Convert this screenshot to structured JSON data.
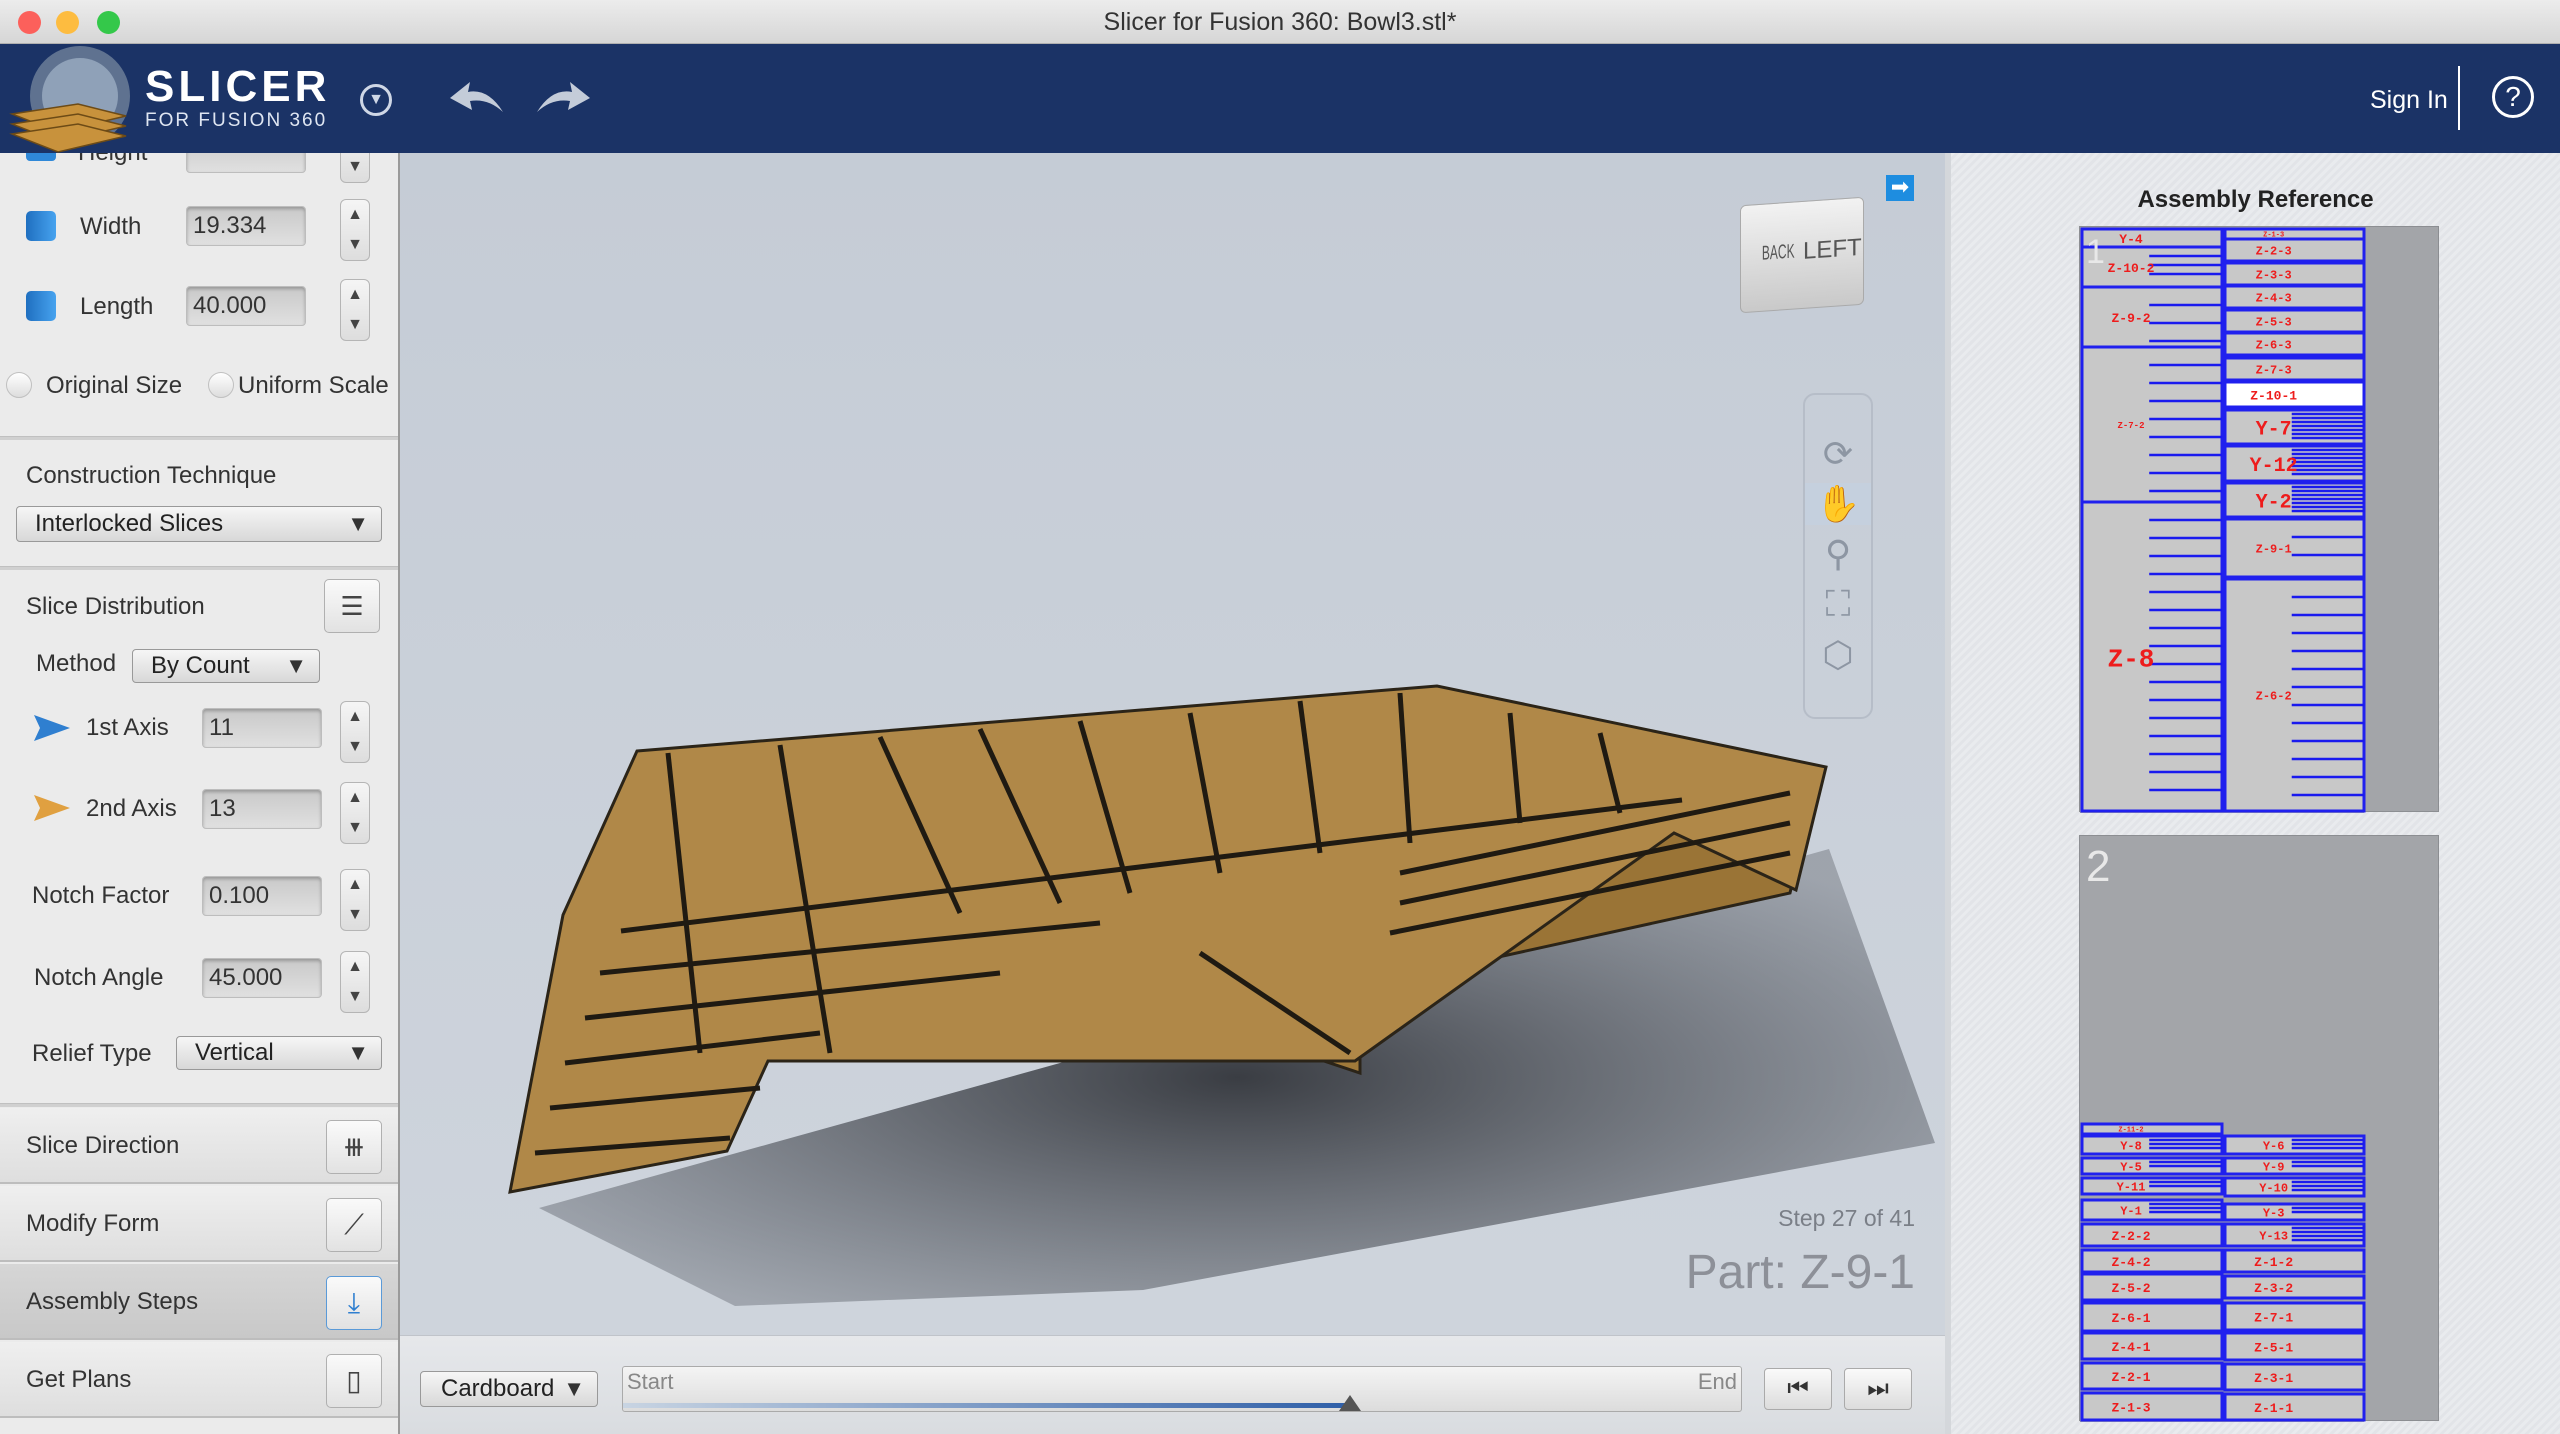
{
  "window": {
    "title": "Slicer for Fusion 360: Bowl3.stl*"
  },
  "header": {
    "logo_main": "SLICER",
    "logo_sub": "FOR FUSION 360",
    "sign_in": "Sign In",
    "help": "?",
    "brand_color": "#1b3366"
  },
  "dimensions": {
    "height_label": "Height",
    "width_label": "Width",
    "width_value": "19.334",
    "length_label": "Length",
    "length_value": "40.000",
    "original_size": "Original Size",
    "uniform_scale": "Uniform Scale"
  },
  "construction": {
    "label": "Construction Technique",
    "value": "Interlocked Slices"
  },
  "slice_distribution": {
    "label": "Slice Distribution",
    "method_label": "Method",
    "method_value": "By Count",
    "axis1_label": "1st Axis",
    "axis1_value": "11",
    "axis2_label": "2nd Axis",
    "axis2_value": "13",
    "notch_factor_label": "Notch Factor",
    "notch_factor_value": "0.100",
    "notch_angle_label": "Notch Angle",
    "notch_angle_value": "45.000",
    "relief_label": "Relief Type",
    "relief_value": "Vertical"
  },
  "sections": [
    {
      "label": "Slice Direction",
      "icon": "slice-direction-icon"
    },
    {
      "label": "Modify Form",
      "icon": "modify-form-icon"
    },
    {
      "label": "Assembly Steps",
      "icon": "assembly-steps-icon",
      "selected": true
    },
    {
      "label": "Get Plans",
      "icon": "get-plans-icon"
    }
  ],
  "viewcube": {
    "back": "BACK",
    "left": "LEFT"
  },
  "viewport": {
    "step": "Step 27 of 41",
    "part": "Part: Z-9-1"
  },
  "bottom": {
    "material": "Cardboard",
    "start": "Start",
    "end": "End",
    "progress": 0.65
  },
  "assembly": {
    "title": "Assembly Reference",
    "sheet1": {
      "number": "1",
      "labels": [
        "Y-4",
        "Z-10-2",
        "Z-9-2",
        "Z-7-2",
        "Z-8",
        "Z-1-3",
        "Z-2-3",
        "Z-3-3",
        "Z-4-3",
        "Z-5-3",
        "Z-6-3",
        "Z-7-3",
        "Z-10-1",
        "Y-7",
        "Y-12",
        "Y-2",
        "Z-9-1",
        "Z-6-2"
      ]
    },
    "sheet2": {
      "number": "2",
      "labels": [
        "Z-11-2",
        "Y-8",
        "Y-5",
        "Y-11",
        "Y-1",
        "Z-2-2",
        "Z-4-2",
        "Z-5-2",
        "Z-6-1",
        "Z-4-1",
        "Z-2-1",
        "Z-1-3",
        "Y-6",
        "Y-9",
        "Y-10",
        "Y-3",
        "Y-13",
        "Z-1-2",
        "Z-3-2",
        "Z-7-1",
        "Z-5-1",
        "Z-3-1",
        "Z-1-1"
      ]
    },
    "highlight_part": "Z-10-1"
  }
}
